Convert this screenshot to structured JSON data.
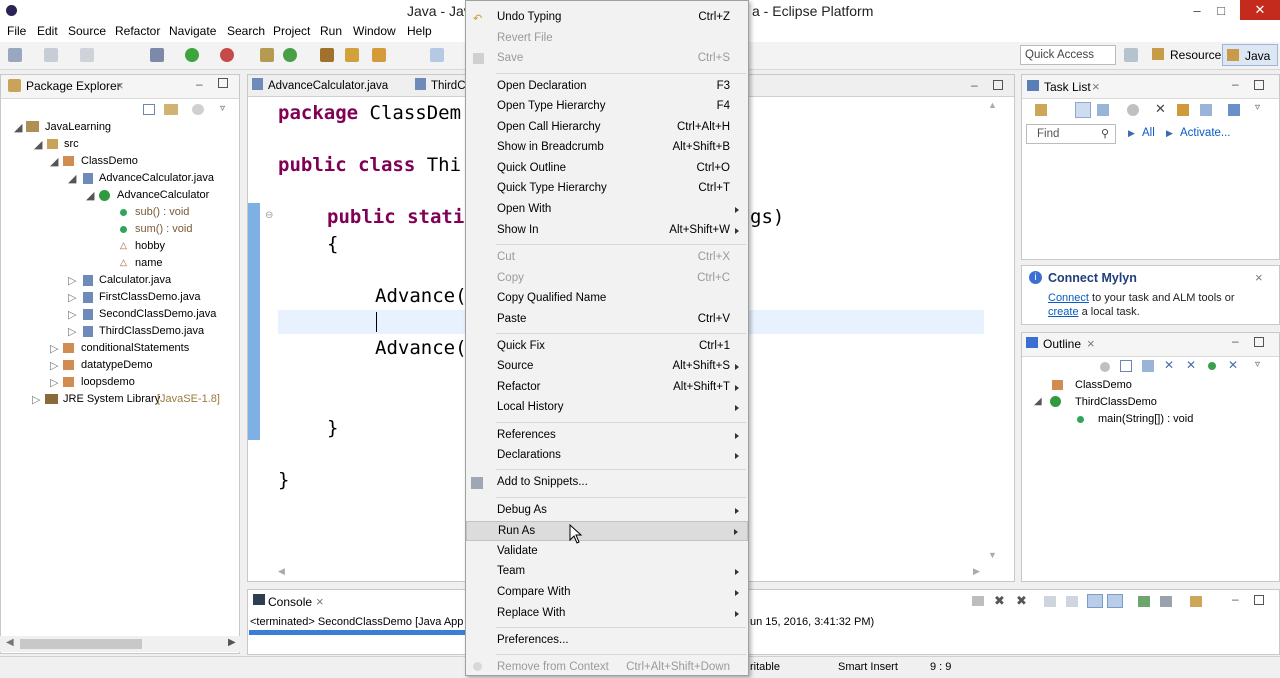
{
  "window": {
    "title_left": "Java - Jav",
    "title_right": "a - Eclipse Platform"
  },
  "menubar": [
    "File",
    "Edit",
    "Source",
    "Refactor",
    "Navigate",
    "Search",
    "Project",
    "Run",
    "Window",
    "Help"
  ],
  "toolbar": {
    "quick_access": "Quick Access",
    "perspective_resource": "Resource",
    "perspective_java": "Java"
  },
  "package_explorer": {
    "title": "Package Explorer",
    "tree": [
      {
        "label": "JavaLearning"
      },
      {
        "label": "src"
      },
      {
        "label": "ClassDemo"
      },
      {
        "label": "AdvanceCalculator.java"
      },
      {
        "label": "AdvanceCalculator"
      },
      {
        "label": "sub() : void"
      },
      {
        "label": "sum() : void"
      },
      {
        "label": "hobby"
      },
      {
        "label": "name"
      },
      {
        "label": "Calculator.java"
      },
      {
        "label": "FirstClassDemo.java"
      },
      {
        "label": "SecondClassDemo.java"
      },
      {
        "label": "ThirdClassDemo.java"
      },
      {
        "label": "conditionalStatements"
      },
      {
        "label": "datatypeDemo"
      },
      {
        "label": "loopsdemo"
      },
      {
        "label": "JRE System Library",
        "suffix": "[JavaSE-1.8]"
      }
    ]
  },
  "editor": {
    "tabs": [
      "AdvanceCalculator.java",
      "ThirdC"
    ],
    "lines": [
      {
        "kw": "package",
        "text": " ClassDem"
      },
      {
        "kw": "public class",
        "text": " Thi"
      },
      {
        "kw": "public stati",
        "text": ""
      },
      {
        "kw": "",
        "text": "{"
      },
      {
        "kw": "",
        "text": "Advance("
      },
      {
        "kw": "",
        "text": "Advance("
      },
      {
        "kw": "",
        "text": "}"
      },
      {
        "kw": "",
        "text": "}"
      }
    ],
    "tail_text": "gs)"
  },
  "task_list": {
    "title": "Task List",
    "find": "Find",
    "all": "All",
    "activate": "Activate..."
  },
  "mylyn": {
    "title": "Connect Mylyn",
    "link1": "Connect",
    "text1": " to your task and ALM tools or",
    "link2": "create",
    "text2": " a local task."
  },
  "outline": {
    "title": "Outline",
    "items": [
      "ClassDemo",
      "ThirdClassDemo",
      "main(String[]) : void"
    ]
  },
  "console": {
    "title": "Console",
    "line_left": "<terminated> SecondClassDemo [Java App",
    "line_right": "un 15, 2016, 3:41:32 PM)"
  },
  "status": {
    "writable": "ritable",
    "insert": "Smart Insert",
    "pos": "9 : 9"
  },
  "context_menu": {
    "items": [
      {
        "label": "Undo Typing",
        "acc": "Ctrl+Z",
        "dis": false
      },
      {
        "label": "Revert File",
        "acc": "",
        "dis": true
      },
      {
        "label": "Save",
        "acc": "Ctrl+S",
        "dis": true
      },
      {
        "label": "Open Declaration",
        "acc": "F3",
        "dis": false
      },
      {
        "label": "Open Type Hierarchy",
        "acc": "F4",
        "dis": false
      },
      {
        "label": "Open Call Hierarchy",
        "acc": "Ctrl+Alt+H",
        "dis": false
      },
      {
        "label": "Show in Breadcrumb",
        "acc": "Alt+Shift+B",
        "dis": false
      },
      {
        "label": "Quick Outline",
        "acc": "Ctrl+O",
        "dis": false
      },
      {
        "label": "Quick Type Hierarchy",
        "acc": "Ctrl+T",
        "dis": false
      },
      {
        "label": "Open With",
        "acc": "",
        "dis": false,
        "sub": true
      },
      {
        "label": "Show In",
        "acc": "Alt+Shift+W",
        "dis": false,
        "sub": true
      },
      {
        "label": "Cut",
        "acc": "Ctrl+X",
        "dis": true
      },
      {
        "label": "Copy",
        "acc": "Ctrl+C",
        "dis": true
      },
      {
        "label": "Copy Qualified Name",
        "acc": "",
        "dis": false
      },
      {
        "label": "Paste",
        "acc": "Ctrl+V",
        "dis": false
      },
      {
        "label": "Quick Fix",
        "acc": "Ctrl+1",
        "dis": false
      },
      {
        "label": "Source",
        "acc": "Alt+Shift+S",
        "dis": false,
        "sub": true
      },
      {
        "label": "Refactor",
        "acc": "Alt+Shift+T",
        "dis": false,
        "sub": true
      },
      {
        "label": "Local History",
        "acc": "",
        "dis": false,
        "sub": true
      },
      {
        "label": "References",
        "acc": "",
        "dis": false,
        "sub": true
      },
      {
        "label": "Declarations",
        "acc": "",
        "dis": false,
        "sub": true
      },
      {
        "label": "Add to Snippets...",
        "acc": "",
        "dis": false
      },
      {
        "label": "Debug As",
        "acc": "",
        "dis": false,
        "sub": true
      },
      {
        "label": "Run As",
        "acc": "",
        "dis": false,
        "sub": true,
        "hl": true
      },
      {
        "label": "Validate",
        "acc": "",
        "dis": false
      },
      {
        "label": "Team",
        "acc": "",
        "dis": false,
        "sub": true
      },
      {
        "label": "Compare With",
        "acc": "",
        "dis": false,
        "sub": true
      },
      {
        "label": "Replace With",
        "acc": "",
        "dis": false,
        "sub": true
      },
      {
        "label": "Preferences...",
        "acc": "",
        "dis": false
      },
      {
        "label": "Remove from Context",
        "acc": "Ctrl+Alt+Shift+Down",
        "dis": true
      }
    ]
  }
}
